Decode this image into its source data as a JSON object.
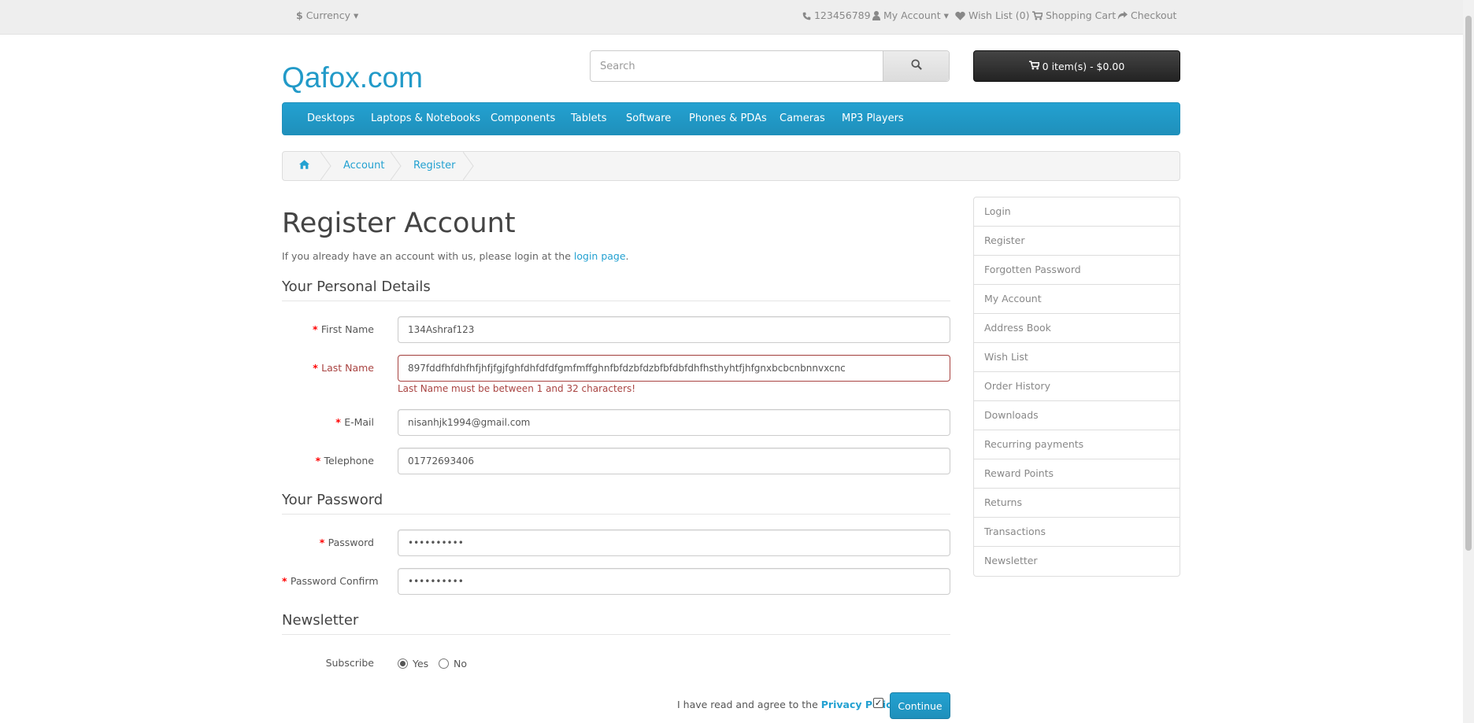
{
  "topbar": {
    "currency": "Currency",
    "phone": "123456789",
    "my_account": "My Account",
    "wish_list": "Wish List (0)",
    "shopping_cart": "Shopping Cart",
    "checkout": "Checkout"
  },
  "header": {
    "logo": "Qafox.com",
    "search_placeholder": "Search",
    "cart_label": "0 item(s) - $0.00"
  },
  "menu": [
    "Desktops",
    "Laptops & Notebooks",
    "Components",
    "Tablets",
    "Software",
    "Phones & PDAs",
    "Cameras",
    "MP3 Players"
  ],
  "breadcrumb": [
    "Account",
    "Register"
  ],
  "page": {
    "title": "Register Account",
    "intro_text": "If you already have an account with us, please login at the ",
    "intro_link": "login page",
    "intro_end": "."
  },
  "personal": {
    "legend": "Your Personal Details",
    "first_name_label": "First Name",
    "first_name_value": "134Ashraf123",
    "last_name_label": "Last Name",
    "last_name_value": "897fddfhfdhfhfjhfjfgjfghfdhfdfdfgmfmffghnfbfdzbfdzbfbfdbfdhfhsthyhtfjhfgnxbcbcnbnnvxcnc",
    "last_name_error": "Last Name must be between 1 and 32 characters!",
    "email_label": "E-Mail",
    "email_value": "nisanhjk1994@gmail.com",
    "telephone_label": "Telephone",
    "telephone_value": "01772693406"
  },
  "password": {
    "legend": "Your Password",
    "password_label": "Password",
    "password_value": "••••••••••",
    "confirm_label": "Password Confirm",
    "confirm_value": "••••••••••"
  },
  "newsletter": {
    "legend": "Newsletter",
    "subscribe_label": "Subscribe",
    "yes": "Yes",
    "no": "No",
    "selected": "Yes"
  },
  "agree": {
    "text": "I have read and agree to the ",
    "link": "Privacy Policy",
    "checked": true,
    "continue": "Continue"
  },
  "sidebar": [
    "Login",
    "Register",
    "Forgotten Password",
    "My Account",
    "Address Book",
    "Wish List",
    "Order History",
    "Downloads",
    "Recurring payments",
    "Reward Points",
    "Returns",
    "Transactions",
    "Newsletter"
  ],
  "colors": {
    "accent": "#229ac8",
    "error": "#a94442",
    "required": "#ff0000"
  }
}
